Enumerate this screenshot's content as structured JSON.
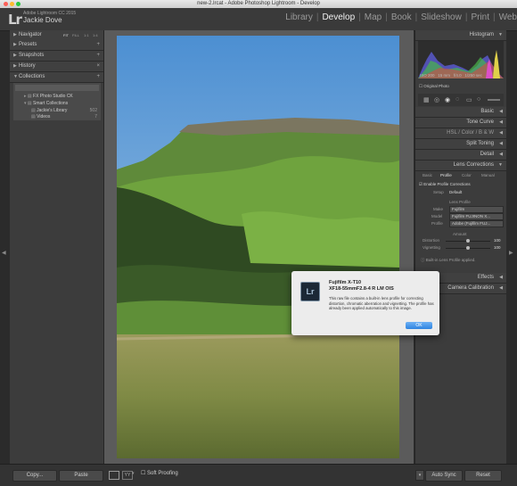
{
  "window_title": "new-2.lrcat - Adobe Photoshop Lightroom - Develop",
  "identity": {
    "logo": "Lr",
    "app_name": "Adobe Lightroom CC 2015",
    "user_name": "Jackie Dove"
  },
  "modules": [
    {
      "label": "Library",
      "active": false
    },
    {
      "label": "Develop",
      "active": true
    },
    {
      "label": "Map",
      "active": false
    },
    {
      "label": "Book",
      "active": false
    },
    {
      "label": "Slideshow",
      "active": false
    },
    {
      "label": "Print",
      "active": false
    },
    {
      "label": "Web",
      "active": false
    }
  ],
  "left_panel": {
    "navigator": {
      "label": "Navigator",
      "zoom_options": [
        "FIT",
        "FILL",
        "1:1",
        "1:4"
      ]
    },
    "presets": "Presets",
    "snapshots": "Snapshots",
    "history": "History",
    "collections": "Collections",
    "collection_items": [
      {
        "label": "FX Photo Studio CK",
        "count": ""
      },
      {
        "label": "Smart Collections",
        "count": ""
      },
      {
        "label": "Jackie's Library",
        "count": "502"
      },
      {
        "label": "Videos",
        "count": "7"
      }
    ],
    "copy_button": "Copy...",
    "paste_button": "Paste"
  },
  "right_panel": {
    "histogram": "Histogram",
    "histogram_readout": [
      "ISO 200",
      "15 mm",
      "f/4.0",
      "1/250 sec"
    ],
    "original_photo": "Original Photo",
    "basic": "Basic",
    "tone_curve": "Tone Curve",
    "hsl": {
      "hsl": "HSL",
      "sep1": "/",
      "color": "Color",
      "sep2": "/",
      "bw": "B & W"
    },
    "split_toning": "Split Toning",
    "detail": "Detail",
    "lens_corrections": "Lens Corrections",
    "lens_tabs": [
      "Basic",
      "Profile",
      "Color",
      "Manual"
    ],
    "enable_profile": "Enable Profile Corrections",
    "setup_label": "Setup",
    "setup_value": "Default",
    "lens_profile_title": "Lens Profile",
    "make_label": "Make",
    "make_value": "Fujifilm",
    "model_label": "Model",
    "model_value": "Fujifilm FUJINON X...",
    "profile_label": "Profile",
    "profile_value": "Adobe (Fujifilm FUJ...",
    "amount_title": "Amount",
    "distortion_label": "Distortion",
    "distortion_value": "100",
    "vignetting_label": "Vignetting",
    "vignetting_value": "100",
    "built_in_note": "Built-in Lens Profile applied.",
    "effects": "Effects",
    "camera_calibration": "Camera Calibration",
    "auto_sync": "Auto Sync",
    "reset": "Reset"
  },
  "toolbar": {
    "soft_proofing": "Soft Proofing"
  },
  "dialog": {
    "title_line1": "Fujifilm X-T10",
    "title_line2": "XF18-55mmF2.8-4 R LM OIS",
    "body": "This raw file contains a built-in lens profile for correcting distortion, chromatic aberration and vignetting. The profile has already been applied automatically to this image.",
    "ok": "OK",
    "icon_text": "Lr"
  },
  "colors": {
    "panel_bg": "#3c3c3c",
    "active_module": "#f0f0f0",
    "dialog_ok": "#2f84e0"
  }
}
